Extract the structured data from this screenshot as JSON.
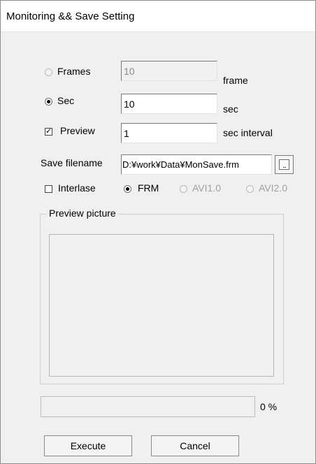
{
  "window": {
    "title": "Monitoring && Save Setting"
  },
  "mode": {
    "frames": {
      "label": "Frames",
      "value": "10",
      "unit": "frame",
      "selected": false,
      "enabled": false
    },
    "sec": {
      "label": "Sec",
      "value": "10",
      "unit": "sec",
      "selected": true
    }
  },
  "preview_option": {
    "label": "Preview",
    "checked": true,
    "value": "1",
    "unit": "sec interval"
  },
  "save_filename": {
    "label": "Save filename",
    "value": "D:¥work¥Data¥MonSave.frm",
    "browse_label": "..."
  },
  "format": {
    "interlase": {
      "label": "Interlase",
      "checked": false
    },
    "options": [
      {
        "label": "FRM",
        "selected": true,
        "enabled": true
      },
      {
        "label": "AVI1.0",
        "selected": false,
        "enabled": false
      },
      {
        "label": "AVI2.0",
        "selected": false,
        "enabled": false
      }
    ]
  },
  "preview_group": {
    "label": "Preview picture"
  },
  "progress": {
    "percent": 0,
    "text": "0 %"
  },
  "buttons": {
    "execute": "Execute",
    "cancel": "Cancel"
  },
  "colors": {
    "dialog_bg": "#f0f0f0",
    "titlebar_bg": "#ffffff",
    "disabled_text": "#a0a0a0"
  }
}
